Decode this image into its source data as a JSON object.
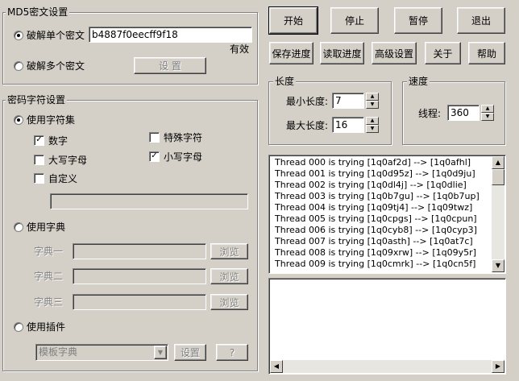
{
  "md5_group": {
    "title": "MD5密文设置",
    "single_label": "破解单个密文",
    "single_value": "b4887f0eecff9f18",
    "valid_text": "有效",
    "multi_label": "破解多个密文",
    "settings_label": "设 置"
  },
  "charset_group": {
    "title": "密码字符设置",
    "use_charset": "使用字符集",
    "digits": "数字",
    "special": "特殊字符",
    "uppercase": "大写字母",
    "lowercase": "小写字母",
    "custom": "自定义",
    "use_dict": "使用字典",
    "dict1": "字典一",
    "dict2": "字典二",
    "dict3": "字典三",
    "browse": "浏览",
    "use_plugin": "使用插件",
    "plugin_select": "模板字典",
    "plugin_settings": "设置",
    "plugin_help": "?"
  },
  "toolbar": {
    "start": "开始",
    "stop": "停止",
    "pause": "暂停",
    "exit": "退出",
    "save_progress": "保存进度",
    "load_progress": "读取进度",
    "advanced": "高级设置",
    "about": "关于",
    "help": "帮助"
  },
  "length_group": {
    "title": "长度",
    "min_label": "最小长度:",
    "min_value": "7",
    "max_label": "最大长度:",
    "max_value": "16"
  },
  "speed_group": {
    "title": "速度",
    "threads_label": "线程:",
    "threads_value": "360"
  },
  "log": {
    "lines": [
      "Thread 000 is trying  [1q0af2d] --> [1q0afhl]",
      "Thread 001 is trying  [1q0d95z] --> [1q0d9ju]",
      "Thread 002 is trying  [1q0dl4j] --> [1q0dlie]",
      "Thread 003 is trying  [1q0b7gu] --> [1q0b7up]",
      "Thread 004 is trying  [1q09tj4] --> [1q09twz]",
      "Thread 005 is trying  [1q0cpgs] --> [1q0cpun]",
      "Thread 006 is trying  [1q0cyb8] --> [1q0cyp3]",
      "Thread 007 is trying  [1q0asth] --> [1q0at7c]",
      "Thread 008 is trying  [1q09xrw] --> [1q09y5r]",
      "Thread 009 is trying  [1q0cmrk] --> [1q0cn5f]"
    ]
  }
}
